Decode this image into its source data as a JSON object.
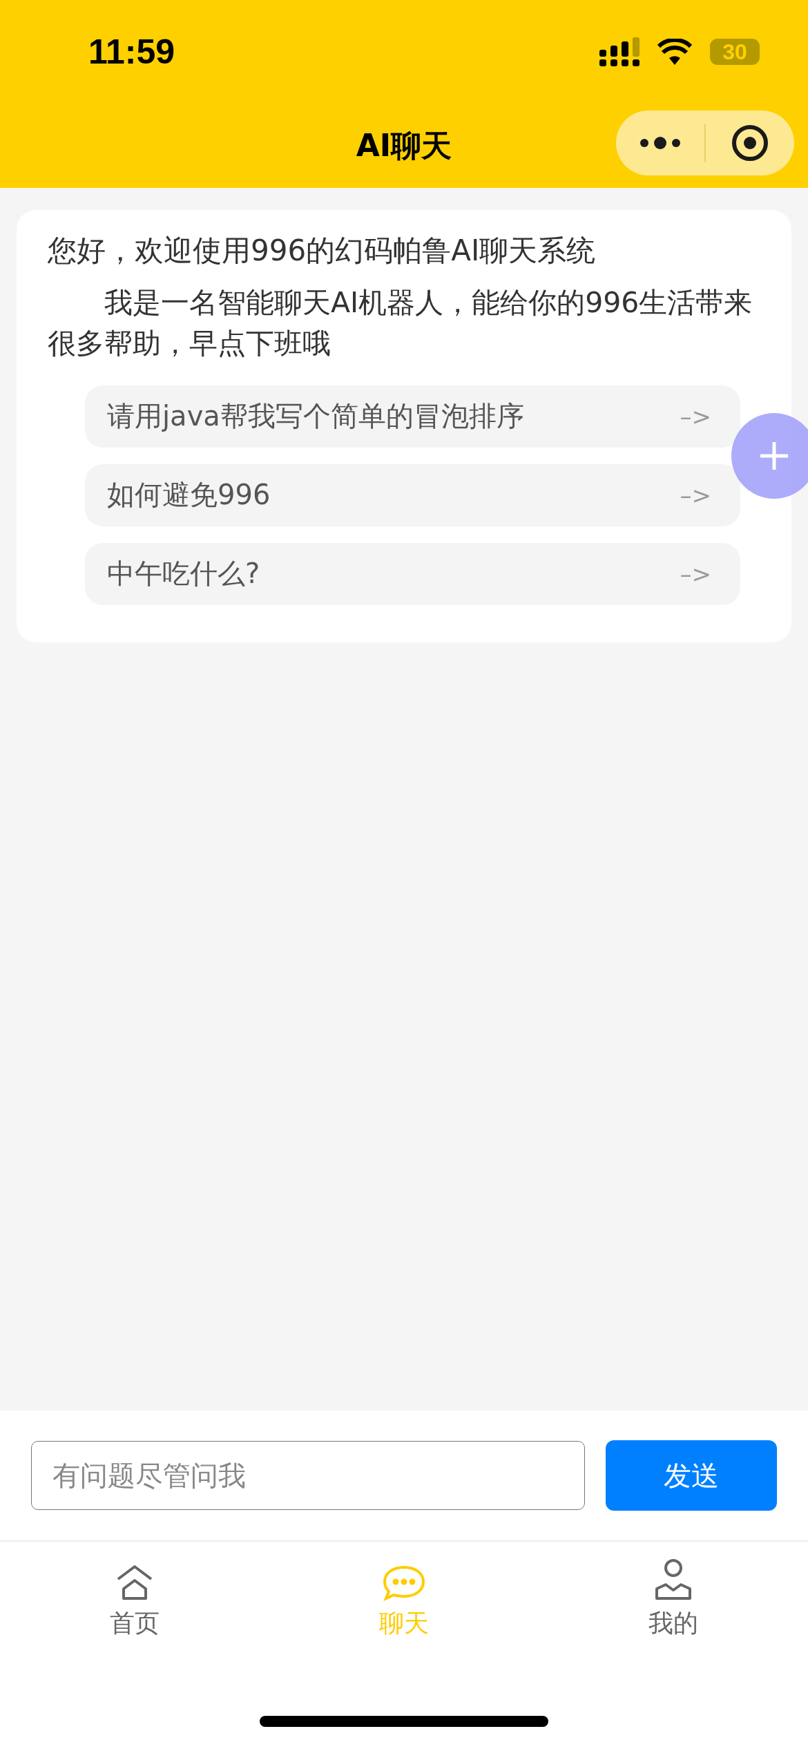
{
  "status_bar": {
    "time": "11:59",
    "battery": "30"
  },
  "nav_bar": {
    "title": "AI聊天"
  },
  "welcome_card": {
    "title": "您好，欢迎使用996的幻码帕鲁AI聊天系统",
    "intro": "我是一名智能聊天AI机器人，能给你的996生活带来很多帮助，早点下班哦",
    "suggestions": [
      {
        "text": "请用java帮我写个简单的冒泡排序",
        "arrow": "–>"
      },
      {
        "text": "如何避免996",
        "arrow": "–>"
      },
      {
        "text": "中午吃什么?",
        "arrow": "–>"
      }
    ]
  },
  "composer": {
    "placeholder": "有问题尽管问我",
    "send": "发送"
  },
  "tab_bar": [
    {
      "kind": "home",
      "label": "首页",
      "selected": false
    },
    {
      "kind": "chat",
      "label": "聊天",
      "selected": true
    },
    {
      "kind": "profile",
      "label": "我的",
      "selected": false
    }
  ]
}
